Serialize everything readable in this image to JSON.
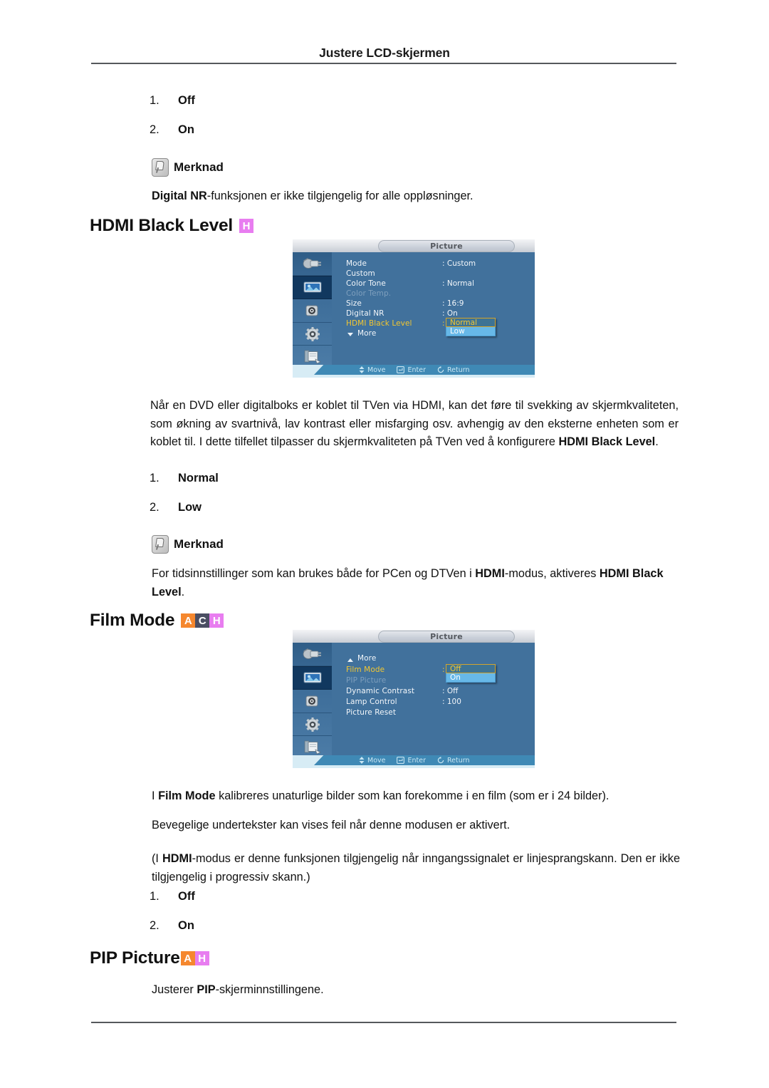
{
  "header": {
    "title": "Justere LCD-skjermen"
  },
  "intro": {
    "list": [
      {
        "num": "1.",
        "label": "Off"
      },
      {
        "num": "2.",
        "label": "On"
      }
    ],
    "note_label": "Merknad",
    "note_text_bold": "Digital NR",
    "note_text_rest": "-funksjonen er ikke tilgjengelig for alle oppløsninger."
  },
  "sections": [
    {
      "id": "hdmi-black-level",
      "heading": "HDMI Black Level",
      "badges": [
        {
          "letter": "H",
          "color": "#e87df0",
          "class": "h"
        }
      ],
      "osd": {
        "title": "Picture",
        "rows": [
          {
            "label": "Mode",
            "value": ": Custom",
            "state": "normal"
          },
          {
            "label": "Custom",
            "value": "",
            "state": "normal"
          },
          {
            "label": "Color Tone",
            "value": ": Normal",
            "state": "normal"
          },
          {
            "label": "Color Temp.",
            "value": "",
            "state": "dim"
          },
          {
            "label": "Size",
            "value": ": 16:9",
            "state": "normal"
          },
          {
            "label": "Digital NR",
            "value": ": On",
            "state": "normal"
          },
          {
            "label": "HDMI Black Level",
            "value": ":",
            "state": "highlight"
          },
          {
            "label": "More",
            "value": "",
            "state": "normal",
            "arrow": "down"
          }
        ],
        "dropdown": {
          "selected": "Normal",
          "other": "Low"
        },
        "footer": [
          {
            "icon": "updown-arrow-icon",
            "label": "Move"
          },
          {
            "icon": "enter-key-icon",
            "label": "Enter"
          },
          {
            "icon": "return-arrow-icon",
            "label": "Return"
          }
        ]
      },
      "paragraph": {
        "pre": "Når en DVD eller digitalboks er koblet til TVen via HDMI, kan det føre til svekking av skjermkvaliteten, som økning av svartnivå, lav kontrast eller misfarging osv. avhengig av den eksterne enheten som er koblet til. I dette tilfellet tilpasser du skjermkvaliteten på TVen ved å konfigurere ",
        "bold": "HDMI Black Level",
        "post": "."
      },
      "list": [
        {
          "num": "1.",
          "label": "Normal"
        },
        {
          "num": "2.",
          "label": "Low"
        }
      ],
      "note_label": "Merknad",
      "note": {
        "pre": "For tidsinnstillinger som kan brukes både for PCen og DTVen i ",
        "b1": "HDMI",
        "mid": "-modus, aktiveres ",
        "b2": "HDMI Black Level",
        "post": "."
      }
    },
    {
      "id": "film-mode",
      "heading": "Film Mode",
      "badges": [
        {
          "letter": "A",
          "color": "#f5872e",
          "class": "a"
        },
        {
          "letter": "C",
          "color": "#4a4e63",
          "class": "c"
        },
        {
          "letter": "H",
          "color": "#e87df0",
          "class": "h"
        }
      ],
      "osd": {
        "title": "Picture",
        "rows": [
          {
            "label": "More",
            "value": "",
            "state": "normal",
            "arrow": "up"
          },
          {
            "label": "Film Mode",
            "value": ":",
            "state": "highlight"
          },
          {
            "label": "PIP Picture",
            "value": "",
            "state": "dim"
          },
          {
            "label": "Dynamic Contrast",
            "value": ": Off",
            "state": "normal"
          },
          {
            "label": "Lamp Control",
            "value": ": 100",
            "state": "normal"
          },
          {
            "label": "Picture Reset",
            "value": "",
            "state": "normal"
          }
        ],
        "dropdown": {
          "selected": "Off",
          "other": "On"
        },
        "footer": [
          {
            "icon": "updown-arrow-icon",
            "label": "Move"
          },
          {
            "icon": "enter-key-icon",
            "label": "Enter"
          },
          {
            "icon": "return-arrow-icon",
            "label": "Return"
          }
        ]
      },
      "paragraphs": [
        {
          "pre": "I ",
          "bold": "Film Mode",
          "post": " kalibreres unaturlige bilder som kan forekomme i en film (som er i 24 bilder)."
        },
        {
          "pre": "Bevegelige undertekster kan vises feil når denne modusen er aktivert.",
          "bold": "",
          "post": ""
        },
        {
          "pre": "(I ",
          "bold": "HDMI",
          "post": "-modus er denne funksjonen tilgjengelig når inngangssignalet er linjesprangskann. Den er ikke tilgjengelig i progressiv skann.)"
        }
      ],
      "list": [
        {
          "num": "1.",
          "label": "Off"
        },
        {
          "num": "2.",
          "label": "On"
        }
      ]
    },
    {
      "id": "pip-picture",
      "heading": "PIP Picture",
      "badges": [
        {
          "letter": "A",
          "color": "#f5872e",
          "class": "a"
        },
        {
          "letter": "H",
          "color": "#e87df0",
          "class": "h"
        }
      ],
      "paragraph": {
        "pre": "Justerer ",
        "bold": "PIP",
        "post": "-skjerminnstillingene."
      }
    }
  ],
  "colors": {
    "osd_panel": "#41719c",
    "osd_highlight_text": "#f2c731",
    "osd_option_blue": "#67b8e8",
    "badge_a": "#f5872e",
    "badge_c": "#4a4e63",
    "badge_h": "#e87df0"
  }
}
